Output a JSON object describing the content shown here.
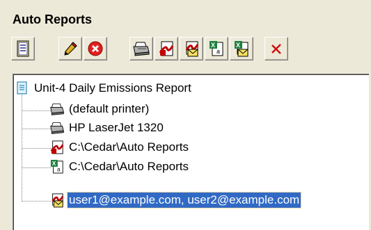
{
  "header": {
    "title": "Auto Reports"
  },
  "toolbar": {
    "buttons": [
      {
        "name": "report-properties-button",
        "icon": "list-document-icon"
      },
      {
        "name": "edit-button",
        "icon": "pencil-icon"
      },
      {
        "name": "delete-button",
        "icon": "red-x-circle-icon"
      },
      {
        "name": "add-printer-button",
        "icon": "printer-icon"
      },
      {
        "name": "add-pdf-button",
        "icon": "pdf-file-icon"
      },
      {
        "name": "add-email-pdf-button",
        "icon": "pdf-email-icon"
      },
      {
        "name": "add-excel-button",
        "icon": "excel-file-icon"
      },
      {
        "name": "add-email-excel-button",
        "icon": "excel-email-icon"
      },
      {
        "name": "remove-button",
        "icon": "red-x-icon"
      }
    ]
  },
  "tree": {
    "root": {
      "label": "Unit-4 Daily Emissions Report",
      "icon": "report-document-icon"
    },
    "children": [
      {
        "label": "(default printer)",
        "icon": "printer-icon"
      },
      {
        "label": "HP LaserJet 1320",
        "icon": "printer-icon"
      },
      {
        "label": "C:\\Cedar\\Auto Reports",
        "icon": "pdf-file-icon"
      },
      {
        "label": "C:\\Cedar\\Auto Reports",
        "icon": "excel-file-icon"
      },
      {
        "label": "user1@example.com, user2@example.com",
        "icon": "pdf-email-icon",
        "selected": true
      }
    ]
  },
  "colors": {
    "selection": "#316ac5",
    "window": "#ece9d8"
  }
}
